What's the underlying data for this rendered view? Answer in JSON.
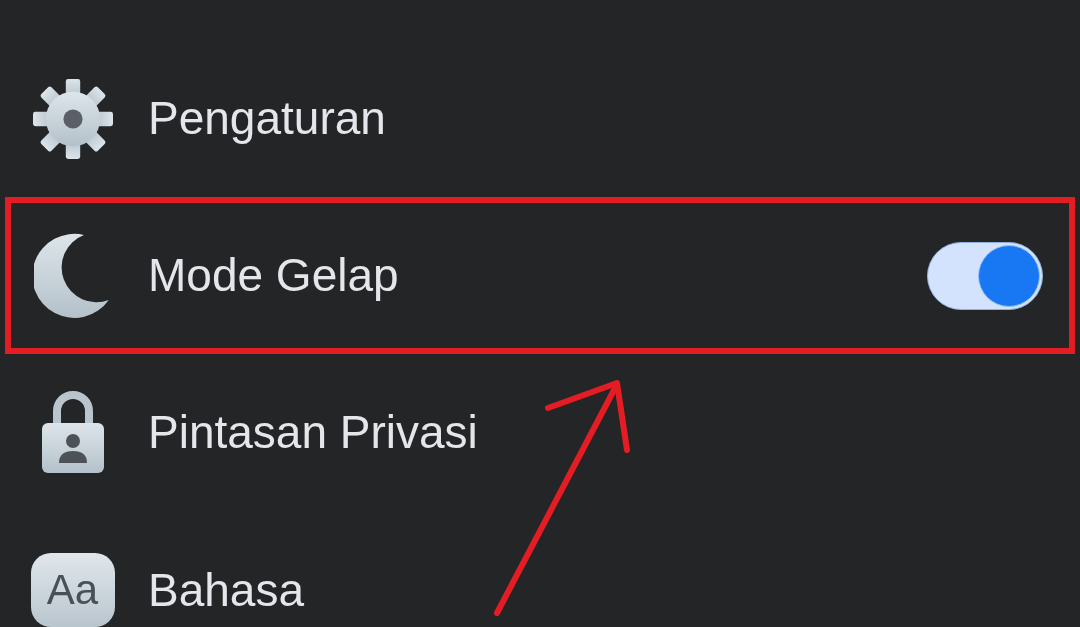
{
  "menu": {
    "items": [
      {
        "kind": "link",
        "label": "Pengaturan",
        "highlighted": false
      },
      {
        "kind": "toggle",
        "label": "Mode Gelap",
        "on": true,
        "highlighted": true
      },
      {
        "kind": "link",
        "label": "Pintasan Privasi",
        "highlighted": false
      },
      {
        "kind": "link",
        "label": "Bahasa",
        "icon_text": "Aa",
        "highlighted": false
      }
    ]
  },
  "pointer_arrow": true
}
